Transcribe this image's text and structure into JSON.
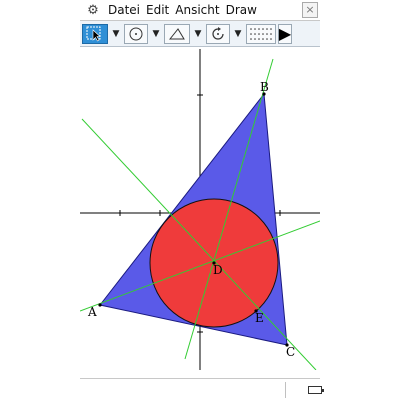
{
  "menu": {
    "items": [
      "Datei",
      "Edit",
      "Ansicht",
      "Draw"
    ],
    "close_label": "×"
  },
  "toolbar": {
    "arrow": "▼",
    "next": "▶"
  },
  "geometry": {
    "points": [
      {
        "label": "A"
      },
      {
        "label": "B"
      },
      {
        "label": "C"
      },
      {
        "label": "D"
      },
      {
        "label": "E"
      }
    ]
  },
  "colors": {
    "triangle_fill": "#5a5ae8",
    "circle_fill": "#ef3b3b",
    "bisector": "#33cc33",
    "axis": "#000000",
    "toolbar_active": "#2f8fd6"
  }
}
